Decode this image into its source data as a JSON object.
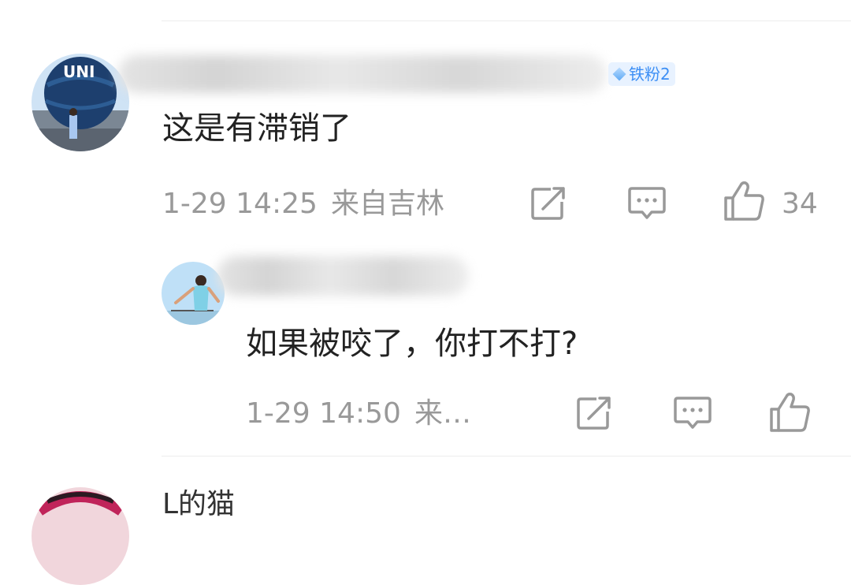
{
  "comment": {
    "badge": "铁粉2",
    "text": "这是有滞销了",
    "time": "1-29 14:25",
    "location": "来自吉林",
    "likes": "34"
  },
  "reply": {
    "text": "如果被咬了，你打不打?",
    "time": "1-29 14:50",
    "location": "来…"
  },
  "next_comment": {
    "name_partial": "L的猫"
  },
  "icons": {
    "share": "share-icon",
    "comment": "comment-icon",
    "like": "thumbs-up-icon"
  },
  "colors": {
    "badge_text": "#3d8ff5",
    "badge_bg": "#e8f2ff",
    "meta": "#999999"
  }
}
